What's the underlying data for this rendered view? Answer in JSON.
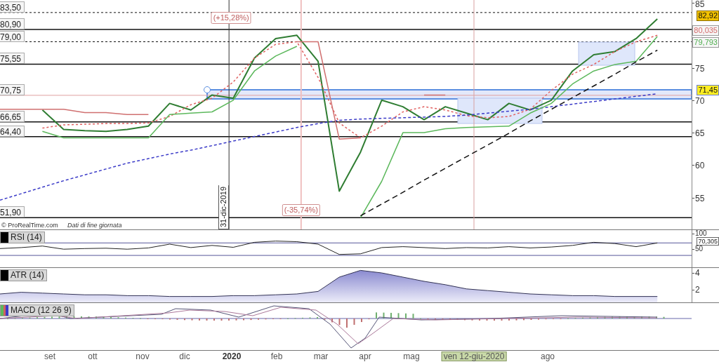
{
  "price_chart": {
    "chart_data": {
      "type": "line",
      "series": [
        {
          "color": "#2f7d32",
          "values": [
            null,
            null,
            68.5,
            65.5,
            65.3,
            65.2,
            65.5,
            66,
            69.5,
            68.5,
            70.8,
            70.3,
            76.5,
            79.5,
            80,
            76,
            56,
            62,
            70,
            69,
            67,
            69,
            68,
            67,
            69.5,
            68.5,
            70,
            74.5,
            77,
            77.5,
            79.5,
            82.5
          ]
        },
        {
          "color": "#e06060",
          "line_style": "dashed",
          "values": [
            null,
            null,
            65.7,
            66.2,
            66.3,
            66.4,
            66.4,
            66.5,
            67.5,
            69.3,
            70.3,
            72.8,
            76.5,
            78.6,
            79,
            73.5,
            66.5,
            64.2,
            66,
            68.2,
            69,
            68.5,
            67.6,
            67.3,
            67.5,
            68.6,
            71.5,
            74,
            75.5,
            77.5,
            79,
            80
          ]
        },
        {
          "color": "#3b3bc8",
          "line_style": "dashed",
          "values": [
            54.6,
            55.6,
            56.6,
            57.6,
            58.5,
            59.4,
            60.3,
            61,
            61.7,
            62.3,
            63,
            63.7,
            64.4,
            65.1,
            65.8,
            66.4,
            66.9,
            67.1,
            67.2,
            67.3,
            67.4,
            67.5,
            67.7,
            68,
            68.3,
            68.6,
            69,
            69.4,
            69.8,
            70.2,
            70.6,
            71
          ]
        },
        {
          "color": "#5cb85c",
          "values": [
            null,
            null,
            65.2,
            64.2,
            64.2,
            64.2,
            64.2,
            64.2,
            67.8,
            68,
            68.2,
            70,
            74.5,
            76.8,
            78.3,
            null,
            null,
            51.9,
            57.5,
            65,
            65,
            65.6,
            65.8,
            65.9,
            66,
            68,
            69.5,
            72.5,
            74.5,
            75.5,
            76,
            79.8
          ]
        },
        {
          "color": "#d07070",
          "values": [
            68.6,
            68.6,
            68.6,
            68.6,
            68.1,
            68.1,
            67.8,
            67.8,
            null,
            null,
            null,
            null,
            null,
            null,
            79,
            79,
            64,
            64.2,
            null,
            null,
            70.8,
            70.8,
            null,
            null,
            null,
            null,
            null,
            null,
            null,
            null,
            null,
            null
          ]
        },
        {
          "color": "#111111",
          "line_style": "dashed",
          "values": [
            null,
            null,
            null,
            null,
            null,
            null,
            null,
            null,
            null,
            null,
            null,
            null,
            null,
            null,
            null,
            null,
            null,
            52.2,
            54,
            55.8,
            57.7,
            59.5,
            61.3,
            63.1,
            64.9,
            66.8,
            68.6,
            70.4,
            72.2,
            74,
            75.9,
            77.7
          ]
        }
      ],
      "ylim": [
        50.1,
        85.43
      ],
      "yticks": [
        55,
        60,
        65,
        70,
        75,
        85
      ],
      "ref_lines": [
        {
          "axis": "y",
          "value": 83.5,
          "label": "83,50",
          "line_style": "dashed"
        },
        {
          "axis": "y",
          "value": 80.9,
          "label": "80,90",
          "line_style": "solid"
        },
        {
          "axis": "y",
          "value": 79.0,
          "label": "79,00",
          "line_style": "dashed"
        },
        {
          "axis": "y",
          "value": 75.55,
          "label": "75,55",
          "line_style": "solid"
        },
        {
          "axis": "y",
          "value": 70.75,
          "label": "70,75",
          "line_style": "solid",
          "color": "#e0a0a0"
        },
        {
          "axis": "y",
          "value": 66.65,
          "label": "66,65",
          "line_style": "solid"
        },
        {
          "axis": "y",
          "value": 64.4,
          "label": "64,40",
          "line_style": "solid"
        },
        {
          "axis": "y",
          "value": 51.9,
          "label": "51,90",
          "line_style": "solid"
        }
      ],
      "bands": [
        {
          "axis": "y",
          "from": 70.2,
          "to": 71.6
        }
      ],
      "annotations": [
        "(+15,28%)",
        "(-35,74%)",
        "31-dic-2019"
      ]
    },
    "tags": [
      {
        "label": "82,92",
        "kind": "price"
      },
      {
        "label": "80,035",
        "kind": "average"
      },
      {
        "label": "79,793",
        "kind": "stop"
      },
      {
        "label": "71,45",
        "kind": "band"
      }
    ],
    "source": {
      "text": "© ProRealTime.com",
      "note": "Dati di fine giornata"
    }
  },
  "rsi": {
    "title": "RSI (14)",
    "tag": "70,305",
    "chart_data": {
      "type": "line",
      "series": [
        {
          "color": "#222222",
          "values": [
            52,
            55,
            60,
            50,
            52,
            53,
            50,
            54,
            66,
            55,
            62,
            56,
            72,
            76,
            74,
            66,
            33,
            35,
            55,
            58,
            55,
            52,
            55,
            54,
            58,
            54,
            57,
            62,
            72,
            68,
            58,
            70
          ]
        }
      ],
      "ylim": [
        -8,
        111
      ],
      "yticks": [
        50,
        100
      ],
      "ref_lines": [
        {
          "axis": "y",
          "value": 70
        },
        {
          "axis": "y",
          "value": 30
        }
      ]
    }
  },
  "atr": {
    "title": "ATR (14)",
    "chart_data": {
      "type": "area",
      "series": [
        {
          "color": "#333355",
          "values": [
            1.5,
            1.7,
            1.6,
            1.5,
            1.4,
            1.4,
            1.3,
            1.3,
            1.2,
            1.2,
            1.2,
            1.3,
            1.3,
            1.4,
            1.5,
            1.8,
            3.5,
            4.3,
            4,
            3.5,
            3,
            2.6,
            2.1,
            1.9,
            1.7,
            1.5,
            1.4,
            1.3,
            1.3,
            1.2,
            1.2,
            1.2
          ]
        }
      ],
      "ylim": [
        0.5,
        4.58
      ],
      "yticks": [
        2,
        4
      ]
    }
  },
  "macd": {
    "title": "MACD (12 26 9)"
  },
  "time_axis": [
    {
      "label": "set",
      "kind": "month"
    },
    {
      "label": "ott",
      "kind": "month"
    },
    {
      "label": "nov",
      "kind": "month"
    },
    {
      "label": "dic",
      "kind": "month"
    },
    {
      "label": "2020",
      "kind": "year"
    },
    {
      "label": "feb",
      "kind": "month"
    },
    {
      "label": "mar",
      "kind": "month"
    },
    {
      "label": "apr",
      "kind": "month"
    },
    {
      "label": "mag",
      "kind": "month"
    },
    {
      "label": "ven 12-giu-2020",
      "kind": "cursor"
    },
    {
      "label": "ago",
      "kind": "month"
    }
  ]
}
